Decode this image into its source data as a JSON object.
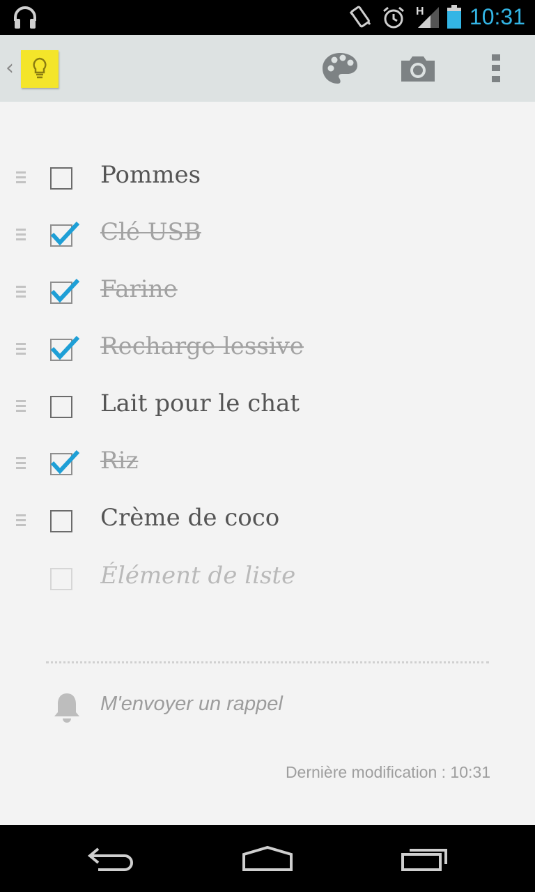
{
  "status_bar": {
    "time": "10:31",
    "network_label": "H",
    "icons": [
      "headphones-icon",
      "vibrate-icon",
      "alarm-icon",
      "signal-icon",
      "battery-icon"
    ]
  },
  "action_bar": {
    "up_icon": "chevron-left-icon",
    "logo_icon": "keep-lightbulb-icon",
    "actions": [
      "palette-icon",
      "camera-icon",
      "overflow-menu-icon"
    ]
  },
  "checklist": {
    "items": [
      {
        "label": "Pommes",
        "checked": false
      },
      {
        "label": "Clé USB",
        "checked": true
      },
      {
        "label": "Farine",
        "checked": true
      },
      {
        "label": "Recharge lessive",
        "checked": true
      },
      {
        "label": "Lait pour le chat",
        "checked": false
      },
      {
        "label": "Riz",
        "checked": true
      },
      {
        "label": "Crème de coco",
        "checked": false
      }
    ],
    "add_placeholder": "Élément de liste"
  },
  "reminder": {
    "label": "M'envoyer un rappel",
    "icon": "bell-icon"
  },
  "footer": {
    "last_modified": "Dernière modification : 10:31"
  },
  "navigation": {
    "buttons": [
      "back-icon",
      "home-icon",
      "recent-apps-icon"
    ]
  },
  "colors": {
    "accent": "#33b5e5",
    "checkmark": "#1e9fd6",
    "action_bar": "#dde2e2",
    "note_logo": "#f4e52a"
  }
}
